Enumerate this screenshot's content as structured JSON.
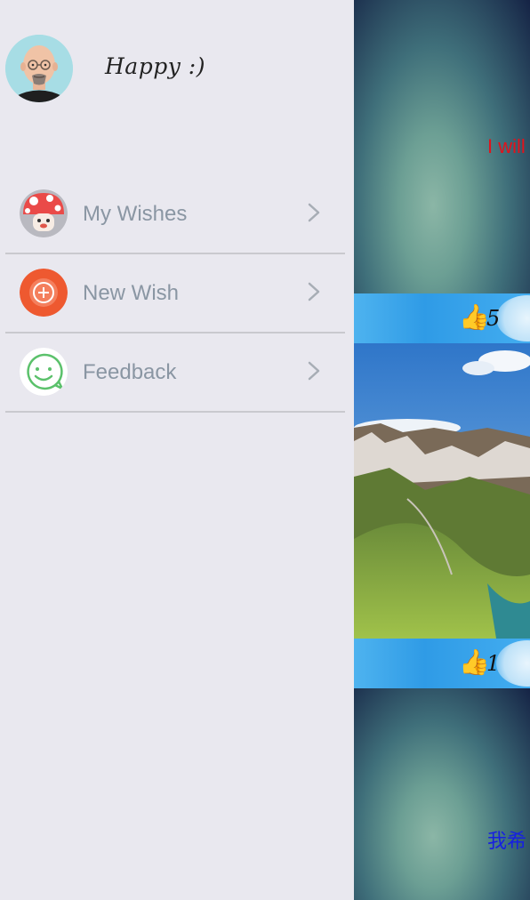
{
  "profile": {
    "greeting": "Happy :)"
  },
  "menu": {
    "items": [
      {
        "label": "My Wishes",
        "icon": "mushroom-icon"
      },
      {
        "label": "New Wish",
        "icon": "plus-circle-icon"
      },
      {
        "label": "Feedback",
        "icon": "smiley-chat-icon"
      }
    ]
  },
  "feed": {
    "card1_text": "I will",
    "card1_color": "#e2121b",
    "bar1_count": "5",
    "bar2_count": "1",
    "card2_text": "我希",
    "card2_color": "#1620e0"
  }
}
